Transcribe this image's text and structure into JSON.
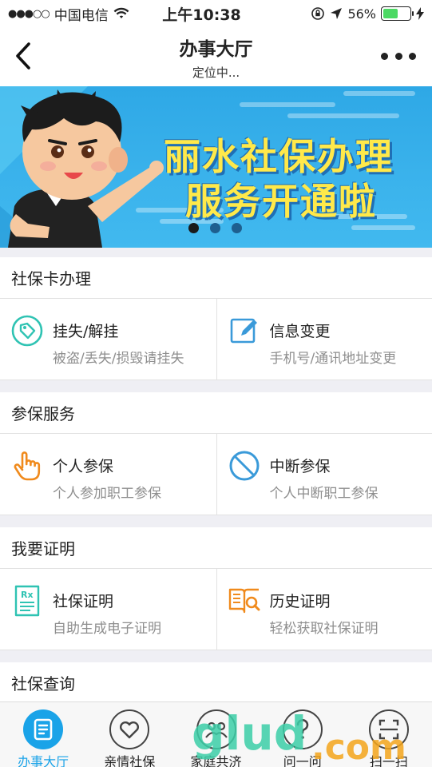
{
  "status_bar": {
    "signal": "●●●○○",
    "carrier": "中国电信",
    "time": "上午10:38",
    "battery_percent": "56%",
    "battery_level": 0.56
  },
  "nav": {
    "title": "办事大厅",
    "subtitle": "定位中..."
  },
  "banner": {
    "line1": "丽水社保办理",
    "line2": "服务开通啦",
    "slide_count": 3,
    "active_slide": 0
  },
  "sections": [
    {
      "title": "社保卡办理",
      "items": [
        {
          "title": "挂失/解挂",
          "desc": "被盗/丢失/损毁请挂失",
          "icon": "tag-icon"
        },
        {
          "title": "信息变更",
          "desc": "手机号/通讯地址变更",
          "icon": "edit-icon"
        }
      ]
    },
    {
      "title": "参保服务",
      "items": [
        {
          "title": "个人参保",
          "desc": "个人参加职工参保",
          "icon": "hand-pointer-icon"
        },
        {
          "title": "中断参保",
          "desc": "个人中断职工参保",
          "icon": "prohibited-icon"
        }
      ]
    },
    {
      "title": "我要证明",
      "items": [
        {
          "title": "社保证明",
          "desc": "自助生成电子证明",
          "icon": "prescription-document-icon"
        },
        {
          "title": "历史证明",
          "desc": "轻松获取社保证明",
          "icon": "book-search-icon"
        }
      ]
    },
    {
      "title": "社保查询",
      "items": []
    }
  ],
  "tabs": [
    {
      "label": "办事大厅",
      "icon": "document-icon",
      "active": true
    },
    {
      "label": "亲情社保",
      "icon": "heart-icon",
      "active": false
    },
    {
      "label": "家庭共济",
      "icon": "family-icon",
      "active": false
    },
    {
      "label": "问一问",
      "icon": "question-icon",
      "active": false
    },
    {
      "label": "扫一扫",
      "icon": "scan-icon",
      "active": false
    }
  ],
  "colors": {
    "accent": "#1aa3e8",
    "banner_bg": "#2ea8e6",
    "banner_text": "#ffe94a",
    "icon_teal": "#2fc3b3",
    "icon_blue": "#3a9ad9",
    "icon_orange": "#f08a1c"
  }
}
